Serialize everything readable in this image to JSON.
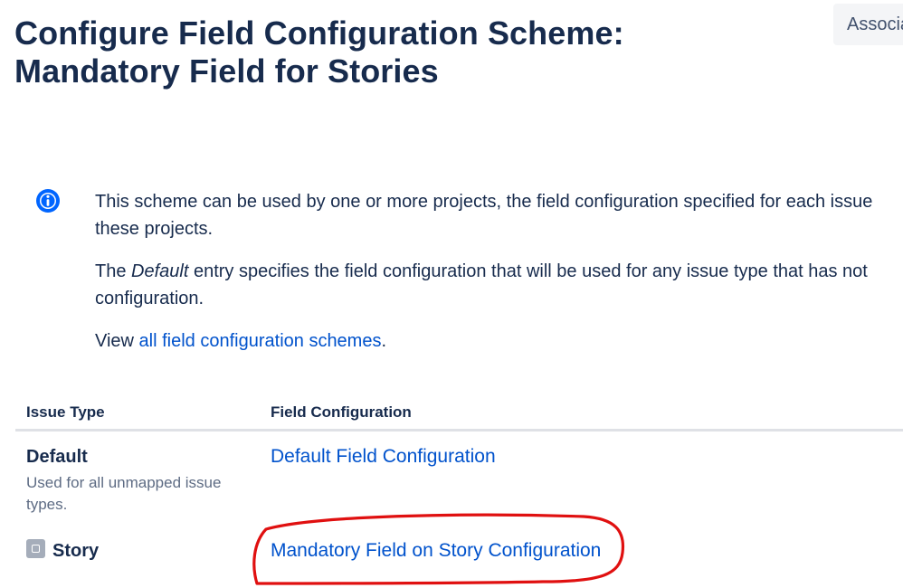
{
  "header": {
    "title": "Configure Field Configuration Scheme: Mandatory Field for Stories",
    "associate_button_label": "Associa"
  },
  "info": {
    "icon": "info-icon",
    "paragraph1_line1": "This scheme can be used by one or more projects, the field configuration specified for each issue",
    "paragraph1_line2": "these projects.",
    "paragraph2_prefix": "The ",
    "paragraph2_em": "Default",
    "paragraph2_line1_rest": " entry specifies the field configuration that will be used for any issue type that has not",
    "paragraph2_line2": "configuration.",
    "paragraph3_prefix": "View ",
    "paragraph3_link": "all field configuration schemes",
    "paragraph3_suffix": "."
  },
  "table": {
    "columns": [
      "Issue Type",
      "Field Configuration"
    ],
    "rows": [
      {
        "issue_type": "Default",
        "description": "Used for all unmapped issue types.",
        "field_configuration": "Default Field Configuration"
      },
      {
        "issue_type": "Story",
        "icon": "story-icon",
        "field_configuration": "Mandatory Field on Story Configuration"
      }
    ]
  },
  "colors": {
    "text": "#172b4d",
    "link": "#0052cc",
    "info_blue": "#0065ff",
    "annotation_red": "#e01010"
  }
}
